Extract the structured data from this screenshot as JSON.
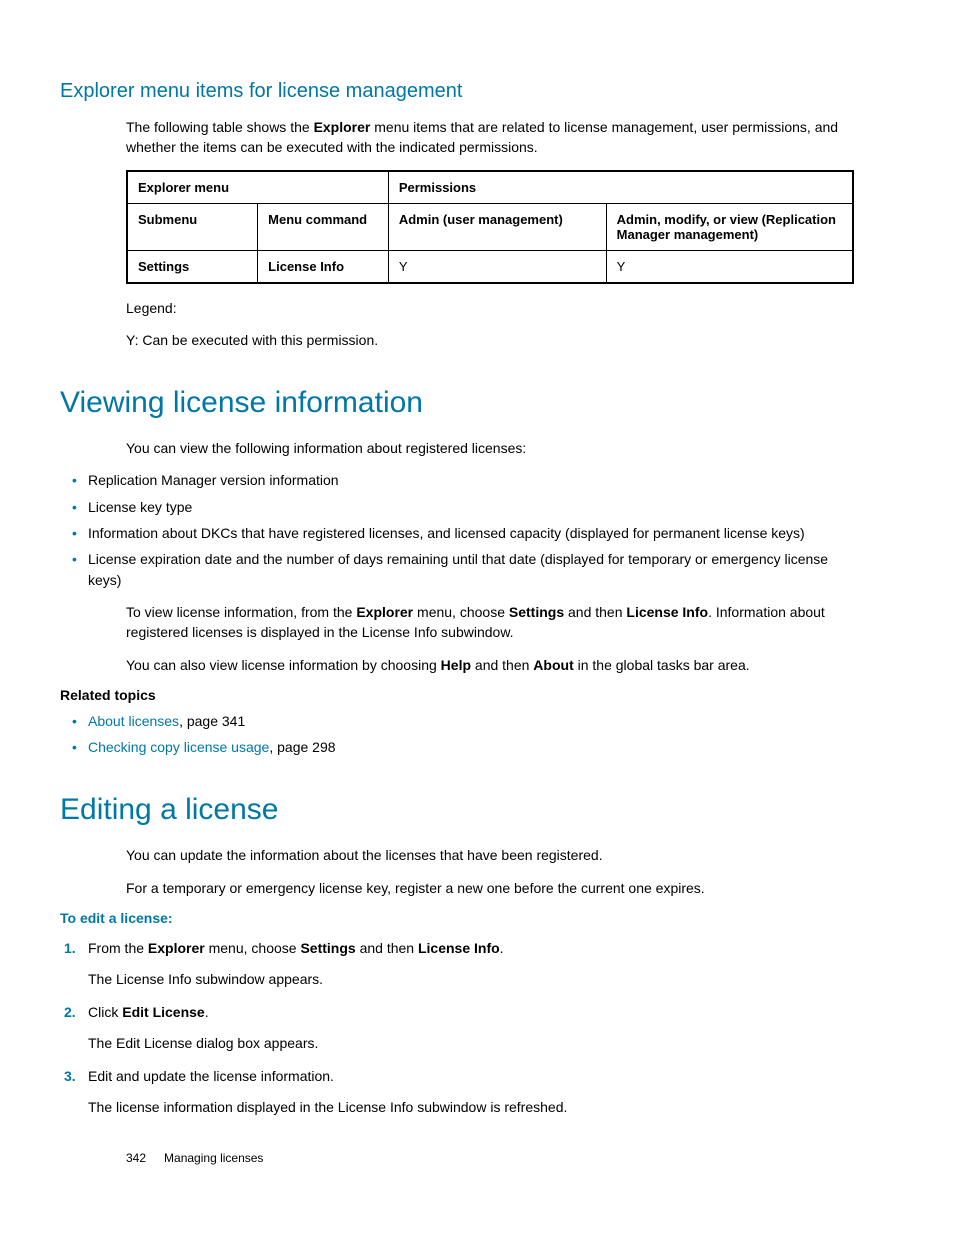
{
  "section1": {
    "heading": "Explorer menu items for license management",
    "intro_pre": "The following table shows the ",
    "intro_bold": "Explorer",
    "intro_post": " menu items that are related to license management, user permissions, and whether the items can be executed with the indicated permissions.",
    "table": {
      "h_explorer": "Explorer menu",
      "h_permissions": "Permissions",
      "h_submenu": "Submenu",
      "h_menucmd": "Menu command",
      "h_admin": "Admin (user management)",
      "h_amv": "Admin, modify, or view (Replication Manager management)",
      "r1_submenu": "Settings",
      "r1_cmd": "License Info",
      "r1_admin": "Y",
      "r1_amv": "Y"
    },
    "legend_label": "Legend:",
    "legend_text": "Y: Can be executed with this permission."
  },
  "section2": {
    "heading": "Viewing license information",
    "intro": "You can view the following information about registered licenses:",
    "bullets": {
      "b1": "Replication Manager version information",
      "b2": "License key type",
      "b3": "Information about DKCs that have registered licenses, and licensed capacity (displayed for permanent license keys)",
      "b4": "License expiration date and the number of days remaining until that date (displayed for temporary or emergency license keys)"
    },
    "p1_a": "To view license information, from the ",
    "p1_b1": "Explorer",
    "p1_c": " menu, choose ",
    "p1_b2": "Settings",
    "p1_d": " and then ",
    "p1_b3": "License Info",
    "p1_e": ". Information about registered licenses is displayed in the License Info subwindow.",
    "p2_a": "You can also view license information by choosing ",
    "p2_b1": "Help",
    "p2_b": " and then ",
    "p2_b2": "About",
    "p2_c": " in the global tasks bar area.",
    "related_heading": "Related topics",
    "related": {
      "r1_link": "About licenses",
      "r1_rest": ", page 341",
      "r2_link": "Checking copy license usage",
      "r2_rest": ", page 298"
    }
  },
  "section3": {
    "heading": "Editing a license",
    "intro1": "You can update the information about the licenses that have been registered.",
    "intro2": "For a temporary or emergency license key, register a new one before the current one expires.",
    "proc_heading": "To edit a license:",
    "steps": {
      "s1_a": "From the ",
      "s1_b1": "Explorer",
      "s1_b": " menu, choose ",
      "s1_b2": "Settings",
      "s1_c": " and then ",
      "s1_b3": "License Info",
      "s1_d": ".",
      "s1_sub": "The License Info subwindow appears.",
      "s2_a": "Click ",
      "s2_b1": "Edit License",
      "s2_b": ".",
      "s2_sub": "The Edit License dialog box appears.",
      "s3": "Edit and update the license information.",
      "s3_sub": "The license information displayed in the License Info subwindow is refreshed."
    }
  },
  "footer": {
    "page_num": "342",
    "title": "Managing licenses"
  }
}
